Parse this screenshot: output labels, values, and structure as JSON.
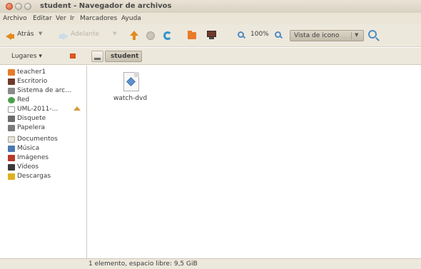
{
  "window": {
    "title": "student - Navegador de archivos"
  },
  "menubar": {
    "items": [
      "Archivo",
      "Editar",
      "Ver",
      "Ir",
      "Marcadores",
      "Ayuda"
    ]
  },
  "toolbar": {
    "back_label": "Atrás",
    "forward_label": "Adelante",
    "zoom_level": "100%",
    "view_mode": "Vista de icono",
    "icons": [
      "back-arrow-icon",
      "forward-arrow-icon",
      "up-arrow-icon",
      "stop-icon",
      "reload-icon",
      "home-folder-icon",
      "computer-icon",
      "zoom-out-icon",
      "zoom-in-icon",
      "search-icon"
    ]
  },
  "location": {
    "places_label": "Lugares ▾",
    "path": [
      "student"
    ]
  },
  "sidebar": {
    "items": [
      {
        "label": "teacher1",
        "icon": "home-folder-icon",
        "color": "#e87b2a"
      },
      {
        "label": "Escritorio",
        "icon": "desktop-icon",
        "color": "#6f3a2a"
      },
      {
        "label": "Sistema de arc...",
        "icon": "filesystem-icon",
        "color": "#8a8a8a"
      },
      {
        "label": "Red",
        "icon": "network-icon",
        "color": "#4aa14a"
      },
      {
        "label": "UML-2011-...",
        "icon": "optical-disc-icon",
        "color": "#9a9a9a"
      },
      {
        "label": "Disquete",
        "icon": "floppy-icon",
        "color": "#6b6b6b"
      },
      {
        "label": "Papelera",
        "icon": "trash-icon",
        "color": "#7a7a7a"
      },
      {
        "label": "Documentos",
        "icon": "documents-folder-icon",
        "color": "#c9c4b9"
      },
      {
        "label": "Música",
        "icon": "music-folder-icon",
        "color": "#4a78b0"
      },
      {
        "label": "Imágenes",
        "icon": "pictures-folder-icon",
        "color": "#b83a2a"
      },
      {
        "label": "Vídeos",
        "icon": "videos-folder-icon",
        "color": "#3a3a3a"
      },
      {
        "label": "Descargas",
        "icon": "downloads-folder-icon",
        "color": "#e0b020"
      }
    ]
  },
  "files": [
    {
      "name": "watch-dvd",
      "icon": "script-file-icon"
    }
  ],
  "status": {
    "text": "1 elemento, espacio libre: 9,5 GiB"
  }
}
